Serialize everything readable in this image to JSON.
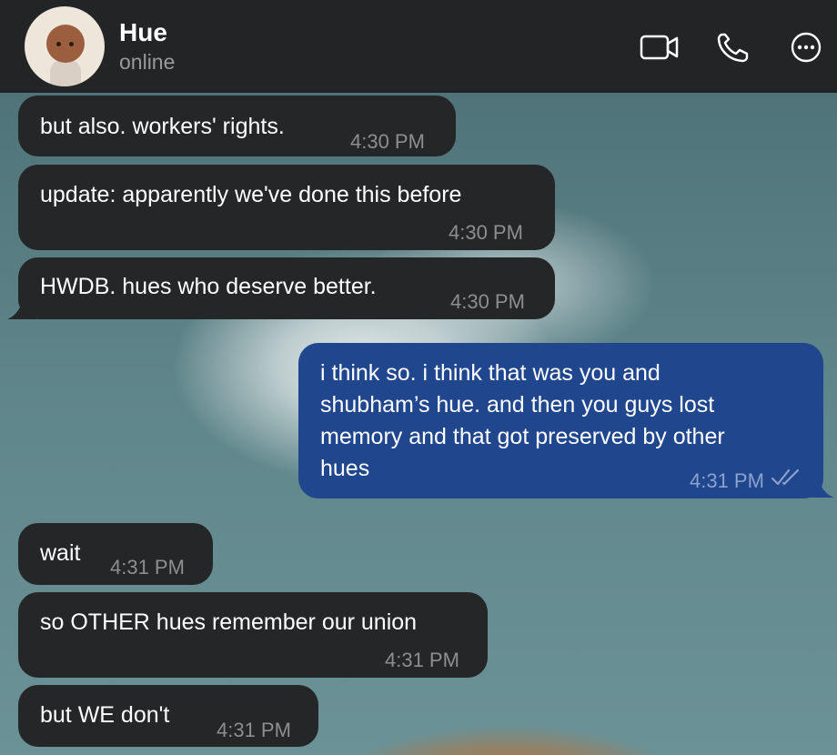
{
  "contact": {
    "name": "Hue",
    "status": "online"
  },
  "header_icons": [
    "video-camera-icon",
    "phone-icon",
    "more-options-icon"
  ],
  "messages": [
    {
      "direction": "incoming",
      "text": "but also. workers' rights.",
      "time": "4:30 PM"
    },
    {
      "direction": "incoming",
      "text": "update: apparently we've done this before",
      "time": "4:30 PM"
    },
    {
      "direction": "incoming",
      "text": "HWDB. hues who deserve better.",
      "time": "4:30 PM"
    },
    {
      "direction": "outgoing",
      "lines": [
        "i think so. i think that was you and",
        "shubham’s hue. and then you guys lost",
        "memory and that got preserved by other",
        "hues"
      ],
      "time": "4:31 PM",
      "read": true
    },
    {
      "direction": "incoming",
      "text": "wait",
      "time": "4:31 PM"
    },
    {
      "direction": "incoming",
      "text": "so OTHER hues remember our union",
      "time": "4:31 PM"
    },
    {
      "direction": "incoming",
      "text": "but WE don't",
      "time": "4:31 PM"
    }
  ],
  "colors": {
    "incoming_bubble": "#252627",
    "outgoing_bubble": "#20468e",
    "header": "#232425"
  }
}
